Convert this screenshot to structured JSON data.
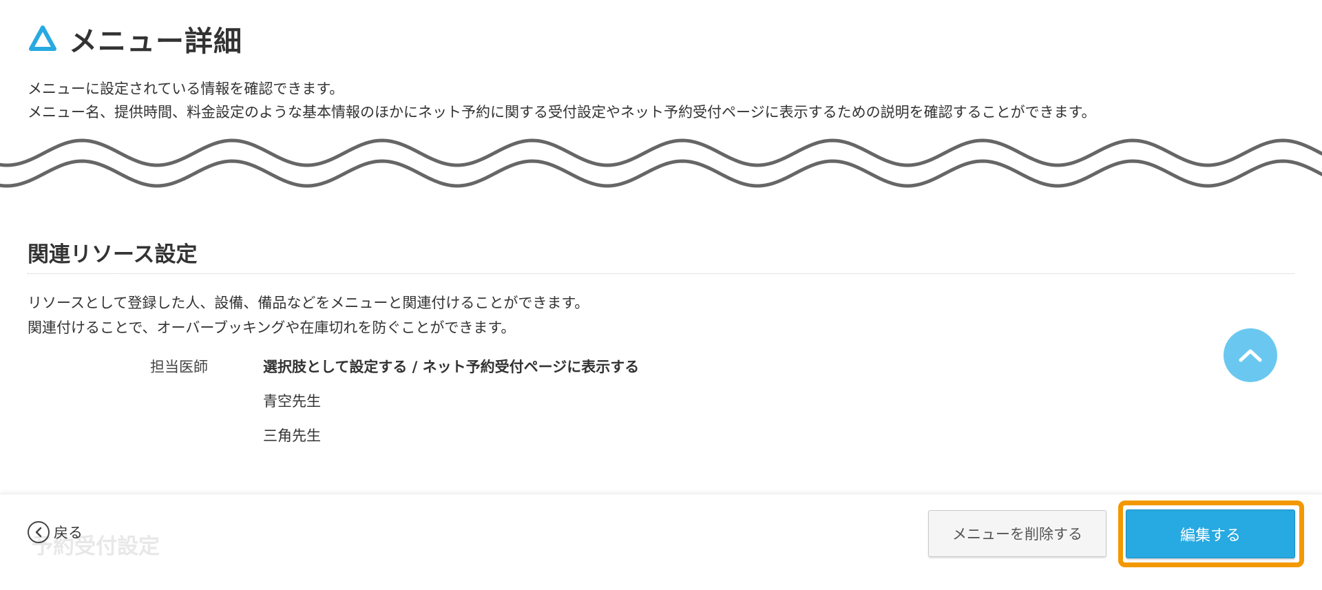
{
  "header": {
    "title": "メニュー詳細",
    "logo_icon": "triangle-logo-icon",
    "accent_color": "#27a9e1"
  },
  "intro": {
    "line1": "メニューに設定されている情報を確認できます。",
    "line2": "メニュー名、提供時間、料金設定のような基本情報のほかにネット予約に関する受付設定やネット予約受付ページに表示するための説明を確認することができます。"
  },
  "resource_section": {
    "title": "関連リソース設定",
    "desc_line1": "リソースとして登録した人、設備、備品などをメニューと関連付けることができます。",
    "desc_line2": "関連付けることで、オーバーブッキングや在庫切れを防ぐことができます。",
    "resource": {
      "label": "担当医師",
      "setting": "選択肢として設定する / ネット予約受付ページに表示する",
      "items": [
        "青空先生",
        "三角先生"
      ]
    }
  },
  "footer": {
    "ghost_heading": "予約受付設定",
    "back_label": "戻る",
    "delete_label": "メニューを削除する",
    "edit_label": "編集する",
    "highlight_color": "#f39800"
  }
}
